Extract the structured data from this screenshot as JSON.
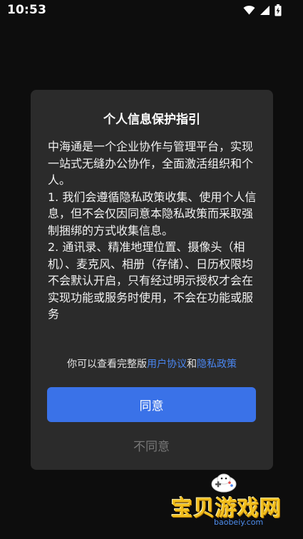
{
  "status_bar": {
    "time": "10:53",
    "icons": [
      "wifi-icon",
      "signal-icon",
      "battery-charging-icon"
    ]
  },
  "dialog": {
    "title": "个人信息保护指引",
    "body": "中海通是一个企业协作与管理平台，实现一站式无缝办公协作，全面激活组织和个人。\n1. 我们会遵循隐私政策收集、使用个人信息，但不会仅因同意本隐私政策而采取强制捆绑的方式收集信息。\n2. 通讯录、精准地理位置、摄像头（相机）、麦克风、相册（存储）、日历权限均不会默认开启，只有经过明示授权才会在实现功能或服务时使用，不会在功能或服务",
    "consent_prefix": "你可以查看完整版",
    "user_agreement_link": "用户协议",
    "consent_and": "和",
    "privacy_policy_link": "隐私政策",
    "agree_label": "同意",
    "disagree_label": "不同意"
  },
  "watermark": {
    "logo_text": "宝贝游戏网",
    "url": "baobeiy.com"
  },
  "colors": {
    "background": "#0d0d0d",
    "dialog_background": "#2b2b2b",
    "accent": "#3a72e8",
    "link": "#4a86f0",
    "muted": "#777777"
  }
}
